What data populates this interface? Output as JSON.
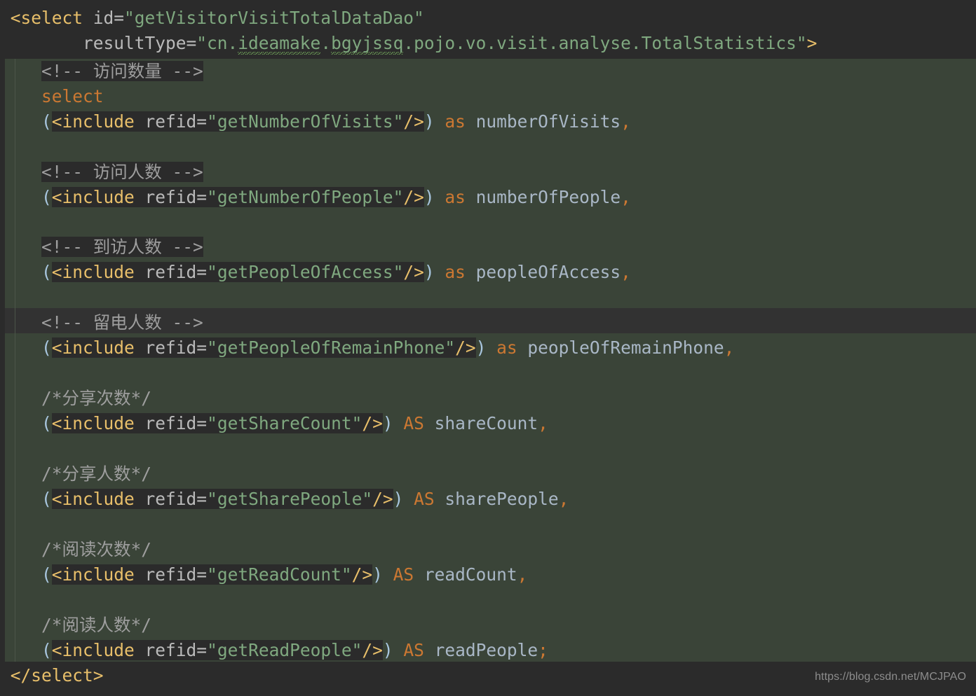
{
  "editor": {
    "language": "XML (MyBatis mapper)",
    "background_color": "#3a4438",
    "highlight_color": "#2b2b2b",
    "current_line_color": "#323232",
    "current_line_number": 13
  },
  "code": {
    "open_tag": "<select ",
    "attr_id_name": "id=",
    "attr_id_value": "\"getVisitorVisitTotalDataDao\"",
    "attr_resulttype_name": "resultType=",
    "attr_resulttype_open_quote": "\"cn.",
    "attr_resulttype_typo1": "ideamake",
    "attr_resulttype_dot1": ".",
    "attr_resulttype_typo2": "bgyjssq",
    "attr_resulttype_tail": ".pojo.vo.visit.analyse.TotalStatistics\"",
    "open_tag_close": ">",
    "close_tag": "</select>",
    "keyword_select": "select",
    "keyword_as_lower": "as",
    "keyword_as_upper": "AS",
    "paren_open": "(",
    "paren_close": ")",
    "include_open": "<include ",
    "refid_attr": "refid=",
    "include_close": "/>",
    "comma": ",",
    "semicolon": ";",
    "lines": [
      {
        "comment": "<!-- 访问数量 -->",
        "comment_style": "xml",
        "refid": "\"getNumberOfVisits\"",
        "alias_keyword": "as",
        "alias": "numberOfVisits",
        "terminator": ","
      },
      {
        "comment": "<!-- 访问人数 -->",
        "comment_style": "xml",
        "refid": "\"getNumberOfPeople\"",
        "alias_keyword": "as",
        "alias": "numberOfPeople",
        "terminator": ","
      },
      {
        "comment": "<!-- 到访人数 -->",
        "comment_style": "xml",
        "refid": "\"getPeopleOfAccess\"",
        "alias_keyword": "as",
        "alias": "peopleOfAccess",
        "terminator": ","
      },
      {
        "comment": "<!-- 留电人数 -->",
        "comment_style": "xml",
        "refid": "\"getPeopleOfRemainPhone\"",
        "alias_keyword": "as",
        "alias": "peopleOfRemainPhone",
        "terminator": ","
      },
      {
        "comment": "/*分享次数*/",
        "comment_style": "block",
        "refid": "\"getShareCount\"",
        "alias_keyword": "AS",
        "alias": "shareCount",
        "terminator": ","
      },
      {
        "comment": "/*分享人数*/",
        "comment_style": "block",
        "refid": "\"getSharePeople\"",
        "alias_keyword": "AS",
        "alias": "sharePeople",
        "terminator": ","
      },
      {
        "comment": "/*阅读次数*/",
        "comment_style": "block",
        "refid": "\"getReadCount\"",
        "alias_keyword": "AS",
        "alias": "readCount",
        "terminator": ","
      },
      {
        "comment": "/*阅读人数*/",
        "comment_style": "block",
        "refid": "\"getReadPeople\"",
        "alias_keyword": "AS",
        "alias": "readPeople",
        "terminator": ";"
      }
    ]
  },
  "watermark": {
    "text": "https://blog.csdn.net/MCJPAO"
  },
  "colors": {
    "tag": "#e8bf6a",
    "attribute": "#bababa",
    "string": "#7fa87f",
    "keyword": "#cc7832",
    "identifier": "#a9b7c6",
    "comment": "#9e9e9e",
    "paren": "#a9c7e0",
    "typo_squiggle": "#6a9955"
  }
}
